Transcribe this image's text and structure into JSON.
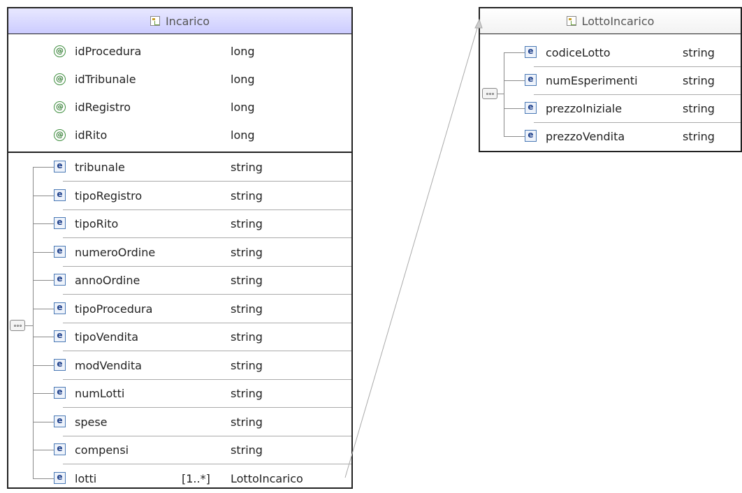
{
  "incarico": {
    "title": "Incarico",
    "header_color": "#ccccff",
    "attributes": [
      {
        "name": "idProcedura",
        "type": "long"
      },
      {
        "name": "idTribunale",
        "type": "long"
      },
      {
        "name": "idRegistro",
        "type": "long"
      },
      {
        "name": "idRito",
        "type": "long"
      }
    ],
    "elements": [
      {
        "name": "tribunale",
        "type": "string",
        "cardinality": ""
      },
      {
        "name": "tipoRegistro",
        "type": "string",
        "cardinality": ""
      },
      {
        "name": "tipoRito",
        "type": "string",
        "cardinality": ""
      },
      {
        "name": "numeroOrdine",
        "type": "string",
        "cardinality": ""
      },
      {
        "name": "annoOrdine",
        "type": "string",
        "cardinality": ""
      },
      {
        "name": "tipoProcedura",
        "type": "string",
        "cardinality": ""
      },
      {
        "name": "tipoVendita",
        "type": "string",
        "cardinality": ""
      },
      {
        "name": "modVendita",
        "type": "string",
        "cardinality": ""
      },
      {
        "name": "numLotti",
        "type": "string",
        "cardinality": ""
      },
      {
        "name": "spese",
        "type": "string",
        "cardinality": ""
      },
      {
        "name": "compensi",
        "type": "string",
        "cardinality": ""
      },
      {
        "name": "lotti",
        "type": "LottoIncarico",
        "cardinality": "[1..*]"
      }
    ]
  },
  "lotto_incarico": {
    "title": "LottoIncarico",
    "header_color": "#f2f2f2",
    "elements": [
      {
        "name": "codiceLotto",
        "type": "string"
      },
      {
        "name": "numEsperimenti",
        "type": "string"
      },
      {
        "name": "prezzoIniziale",
        "type": "string"
      },
      {
        "name": "prezzoVendita",
        "type": "string"
      }
    ]
  },
  "icons": {
    "attribute": "attribute-icon",
    "element": "element-icon",
    "sequence": "sequence-icon",
    "type": "complex-type-icon"
  },
  "glyphs": {
    "attribute": "@",
    "element": "e"
  }
}
